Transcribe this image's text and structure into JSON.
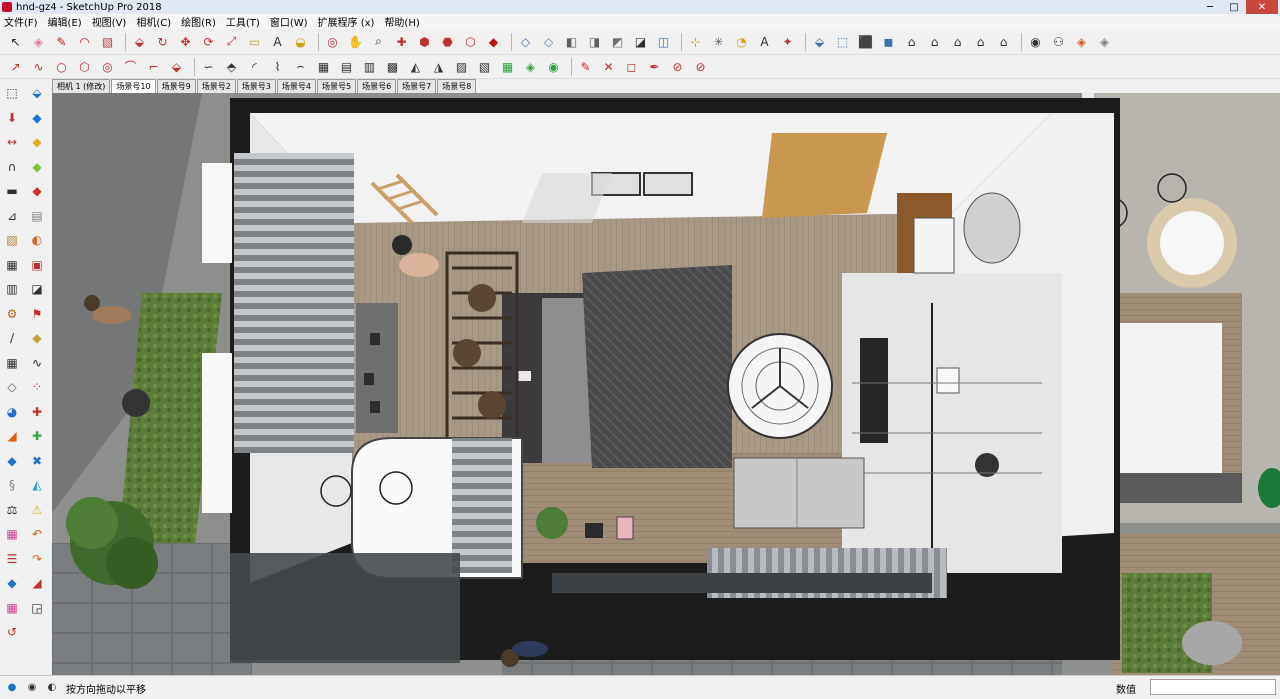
{
  "window": {
    "title": "hnd-gz4 - SketchUp Pro 2018",
    "controls": {
      "minimize": "─",
      "maximize": "□",
      "close": "✕"
    }
  },
  "menu": [
    "文件(F)",
    "编辑(E)",
    "视图(V)",
    "相机(C)",
    "绘图(R)",
    "工具(T)",
    "窗口(W)",
    "扩展程序 (x)",
    "帮助(H)"
  ],
  "toolbar1": [
    {
      "icon": "select-icon",
      "glyph": "↖",
      "color": "#222222"
    },
    {
      "icon": "eraser-icon",
      "glyph": "◈",
      "color": "#e07aa0"
    },
    {
      "icon": "pencil-icon",
      "glyph": "✎",
      "color": "#b02020"
    },
    {
      "icon": "arc-icon",
      "glyph": "◠",
      "color": "#b02020"
    },
    {
      "icon": "rectangle-icon",
      "glyph": "▧",
      "color": "#b04040"
    },
    {
      "icon": "push-pull-icon",
      "glyph": "⬙",
      "color": "#c03030"
    },
    {
      "icon": "follow-me-icon",
      "glyph": "↻",
      "color": "#c03030"
    },
    {
      "icon": "move-icon",
      "glyph": "✥",
      "color": "#c03030"
    },
    {
      "icon": "rotate-icon",
      "glyph": "⟳",
      "color": "#c03030"
    },
    {
      "icon": "scale-icon",
      "glyph": "⤢",
      "color": "#c03030"
    },
    {
      "icon": "tape-measure-icon",
      "glyph": "▭",
      "color": "#c0a040"
    },
    {
      "icon": "text-icon",
      "glyph": "A",
      "color": "#303030"
    },
    {
      "icon": "paint-bucket-icon",
      "glyph": "◒",
      "color": "#d0a020"
    },
    {
      "icon": "orbit-icon",
      "glyph": "◎",
      "color": "#c03030"
    },
    {
      "icon": "pan-icon",
      "glyph": "✋",
      "color": "#b08040"
    },
    {
      "icon": "zoom-icon",
      "glyph": "⌕",
      "color": "#303060"
    },
    {
      "icon": "zoom-extents-icon",
      "glyph": "✚",
      "color": "#c03030"
    },
    {
      "icon": "warehouse-icon",
      "glyph": "⬢",
      "color": "#c03030"
    },
    {
      "icon": "extension-warehouse-icon",
      "glyph": "⬣",
      "color": "#c03030"
    },
    {
      "icon": "share-model-icon",
      "glyph": "⬡",
      "color": "#c03030"
    },
    {
      "icon": "ruby-console-icon",
      "glyph": "◆",
      "color": "#c01010"
    },
    {
      "icon": "xray-icon",
      "glyph": "◇",
      "color": "#4070b0"
    },
    {
      "icon": "back-edges-icon",
      "glyph": "◇",
      "color": "#6080a0"
    },
    {
      "icon": "wireframe-icon",
      "glyph": "◧",
      "color": "#606060"
    },
    {
      "icon": "hidden-line-icon",
      "glyph": "◨",
      "color": "#606060"
    },
    {
      "icon": "shaded-icon",
      "glyph": "◩",
      "color": "#707070"
    },
    {
      "icon": "shaded-textures-icon",
      "glyph": "◪",
      "color": "#303030"
    },
    {
      "icon": "monochrome-icon",
      "glyph": "◫",
      "color": "#4070b0"
    },
    {
      "icon": "axes-icon",
      "glyph": "⊹",
      "color": "#d0a000"
    },
    {
      "icon": "guides-icon",
      "glyph": "✳",
      "color": "#606060"
    },
    {
      "icon": "protractor-icon",
      "glyph": "◔",
      "color": "#d0a000"
    },
    {
      "icon": "dimension-icon",
      "glyph": "A",
      "color": "#303030"
    },
    {
      "icon": "section-plane-icon",
      "glyph": "✦",
      "color": "#c03030"
    },
    {
      "icon": "iso-view-icon",
      "glyph": "⬙",
      "color": "#4070b0"
    },
    {
      "icon": "top-view-icon",
      "glyph": "⬚",
      "color": "#4070b0"
    },
    {
      "icon": "front-view-icon",
      "glyph": "⬛",
      "color": "#4070b0"
    },
    {
      "icon": "right-view-icon",
      "glyph": "◼",
      "color": "#4070b0"
    },
    {
      "icon": "back-view-icon",
      "glyph": "⌂",
      "color": "#303030"
    },
    {
      "icon": "left-view-icon",
      "glyph": "⌂",
      "color": "#303030"
    },
    {
      "icon": "position-camera-icon",
      "glyph": "⌂",
      "color": "#303030"
    },
    {
      "icon": "walk-icon",
      "glyph": "⌂",
      "color": "#303030"
    },
    {
      "icon": "look-around-icon",
      "glyph": "⌂",
      "color": "#303030"
    },
    {
      "icon": "solid-tools-icon",
      "glyph": "◉",
      "color": "#303030"
    },
    {
      "icon": "sandbox-icon",
      "glyph": "⚇",
      "color": "#303030"
    },
    {
      "icon": "layers-icon",
      "glyph": "◈",
      "color": "#d06020"
    },
    {
      "icon": "styles-icon",
      "glyph": "◈",
      "color": "#808080"
    }
  ],
  "toolbar2": [
    {
      "icon": "line-icon",
      "glyph": "↗",
      "color": "#c03030"
    },
    {
      "icon": "freehand-icon",
      "glyph": "∿",
      "color": "#c03030"
    },
    {
      "icon": "circle-icon",
      "glyph": "○",
      "color": "#c03030"
    },
    {
      "icon": "polygon-icon",
      "glyph": "⬡",
      "color": "#c03030"
    },
    {
      "icon": "offset-icon",
      "glyph": "◎",
      "color": "#c03030"
    },
    {
      "icon": "weld-icon",
      "glyph": "⌒",
      "color": "#c03030"
    },
    {
      "icon": "fillet-icon",
      "glyph": "⌐",
      "color": "#c03030"
    },
    {
      "icon": "extrude-icon",
      "glyph": "⬙",
      "color": "#c03030"
    },
    {
      "icon": "curve-icon",
      "glyph": "∽",
      "color": "#303030"
    },
    {
      "icon": "joint-push-pull-icon",
      "glyph": "⬘",
      "color": "#303030"
    },
    {
      "icon": "round-corner-icon",
      "glyph": "◜",
      "color": "#303030"
    },
    {
      "icon": "loft-icon",
      "glyph": "⌇",
      "color": "#303030"
    },
    {
      "icon": "shape-bender-icon",
      "glyph": "⌢",
      "color": "#303030"
    },
    {
      "icon": "subdivide-icon",
      "glyph": "▦",
      "color": "#303030"
    },
    {
      "icon": "profile-builder-icon",
      "glyph": "▤",
      "color": "#303030"
    },
    {
      "icon": "stair-icon",
      "glyph": "▥",
      "color": "#303030"
    },
    {
      "icon": "array-icon",
      "glyph": "▩",
      "color": "#303030"
    },
    {
      "icon": "mirror-icon",
      "glyph": "◭",
      "color": "#303030"
    },
    {
      "icon": "cleanup-icon",
      "glyph": "◮",
      "color": "#303030"
    },
    {
      "icon": "hatch-icon",
      "glyph": "▨",
      "color": "#303030"
    },
    {
      "icon": "texture-icon",
      "glyph": "▧",
      "color": "#303030"
    },
    {
      "icon": "uv-map-icon",
      "glyph": "▦",
      "color": "#30a040"
    },
    {
      "icon": "material-icon",
      "glyph": "◈",
      "color": "#30a040"
    },
    {
      "icon": "component-icon",
      "glyph": "◉",
      "color": "#30a040"
    },
    {
      "icon": "draw-icon",
      "glyph": "✎",
      "color": "#c03030"
    },
    {
      "icon": "cross-icon",
      "glyph": "✕",
      "color": "#c03030"
    },
    {
      "icon": "box-icon",
      "glyph": "◻",
      "color": "#c03030"
    },
    {
      "icon": "pen-icon",
      "glyph": "✒",
      "color": "#c03030"
    },
    {
      "icon": "no-entry-icon",
      "glyph": "⊘",
      "color": "#c03030"
    },
    {
      "icon": "slash-circle-icon",
      "glyph": "⊘",
      "color": "#c03030"
    }
  ],
  "scene_tabs": [
    "相机 1 (修改)",
    "场景号10",
    "场景号9",
    "场景号2",
    "场景号3",
    "场景号4",
    "场景号5",
    "场景号6",
    "场景号7",
    "场景号8"
  ],
  "active_scene": 1,
  "left_palette": [
    {
      "icon": "make-component-icon",
      "glyph": "⬚",
      "color": "#303030"
    },
    {
      "icon": "paint-icon",
      "glyph": "⬙",
      "color": "#2070d0"
    },
    {
      "icon": "push-pull-icon",
      "glyph": "⬇",
      "color": "#c03030"
    },
    {
      "icon": "box-blue-icon",
      "glyph": "◆",
      "color": "#2070d0"
    },
    {
      "icon": "move-icon",
      "glyph": "↔",
      "color": "#c03030"
    },
    {
      "icon": "folder-icon",
      "glyph": "◆",
      "color": "#e0b020"
    },
    {
      "icon": "arc-icon",
      "glyph": "∩",
      "color": "#303030"
    },
    {
      "icon": "tag-icon",
      "glyph": "◆",
      "color": "#80c040"
    },
    {
      "icon": "line-icon",
      "glyph": "▬",
      "color": "#303030"
    },
    {
      "icon": "red-box-icon",
      "glyph": "◆",
      "color": "#d03030"
    },
    {
      "icon": "dimension-icon",
      "glyph": "⊿",
      "color": "#303030"
    },
    {
      "icon": "book-icon",
      "glyph": "▤",
      "color": "#808080"
    },
    {
      "icon": "ruler-icon",
      "glyph": "▨",
      "color": "#b08040"
    },
    {
      "icon": "rotate-icon",
      "glyph": "◐",
      "color": "#e06010"
    },
    {
      "icon": "stair-icon",
      "glyph": "▦",
      "color": "#303030"
    },
    {
      "icon": "panel-icon",
      "glyph": "▣",
      "color": "#c03030"
    },
    {
      "icon": "table-icon",
      "glyph": "▥",
      "color": "#303030"
    },
    {
      "icon": "window-icon",
      "glyph": "◪",
      "color": "#303030"
    },
    {
      "icon": "gear-icon",
      "glyph": "⚙",
      "color": "#b07020"
    },
    {
      "icon": "flag-icon",
      "glyph": "⚑",
      "color": "#c03030"
    },
    {
      "icon": "knife-icon",
      "glyph": "∕",
      "color": "#303030"
    },
    {
      "icon": "cube-icon",
      "glyph": "◆",
      "color": "#c0a040"
    },
    {
      "icon": "grid-icon",
      "glyph": "▦",
      "color": "#303030"
    },
    {
      "icon": "curve-icon",
      "glyph": "∿",
      "color": "#303030"
    },
    {
      "icon": "sandbox-icon",
      "glyph": "◇",
      "color": "#606060"
    },
    {
      "icon": "dots-icon",
      "glyph": "⁘",
      "color": "#c03030"
    },
    {
      "icon": "eye-icon",
      "glyph": "◕",
      "color": "#2070d0"
    },
    {
      "icon": "plus-red-icon",
      "glyph": "✚",
      "color": "#c03030"
    },
    {
      "icon": "triangle-icon",
      "glyph": "◢",
      "color": "#e06010"
    },
    {
      "icon": "plus-green-icon",
      "glyph": "✚",
      "color": "#30a040"
    },
    {
      "icon": "cube-blue-icon",
      "glyph": "◆",
      "color": "#2070d0"
    },
    {
      "icon": "cross-blue-icon",
      "glyph": "✖",
      "color": "#2070d0"
    },
    {
      "icon": "shape-icon",
      "glyph": "§",
      "color": "#808080"
    },
    {
      "icon": "drop-icon",
      "glyph": "◭",
      "color": "#30a0c0"
    },
    {
      "icon": "scale-icon",
      "glyph": "⚖",
      "color": "#303030"
    },
    {
      "icon": "warning-icon",
      "glyph": "⚠",
      "color": "#e0b020"
    },
    {
      "icon": "palette-icon",
      "glyph": "▦",
      "color": "#d04090"
    },
    {
      "icon": "undo-icon",
      "glyph": "↶",
      "color": "#e06010"
    },
    {
      "icon": "list-icon",
      "glyph": "☰",
      "color": "#c03030"
    },
    {
      "icon": "redo-icon",
      "glyph": "↷",
      "color": "#e06010"
    },
    {
      "icon": "cube-outline-icon",
      "glyph": "◆",
      "color": "#2070d0"
    },
    {
      "icon": "triangle-red-icon",
      "glyph": "◢",
      "color": "#c03030"
    },
    {
      "icon": "palette2-icon",
      "glyph": "▦",
      "color": "#d04090"
    },
    {
      "icon": "corner-icon",
      "glyph": "◲",
      "color": "#303030"
    },
    {
      "icon": "back-icon",
      "glyph": "↺",
      "color": "#c03030"
    }
  ],
  "status": {
    "hint": "按方向拖动以平移",
    "measurements_label": "数值",
    "measurements_value": ""
  },
  "colors": {
    "accent": "#2070d0",
    "viewport_ground": "#8c8f8c",
    "wall": "#f2f2f2",
    "floor_wood": "#a89886",
    "bed_dark": "#4a4a4c"
  }
}
